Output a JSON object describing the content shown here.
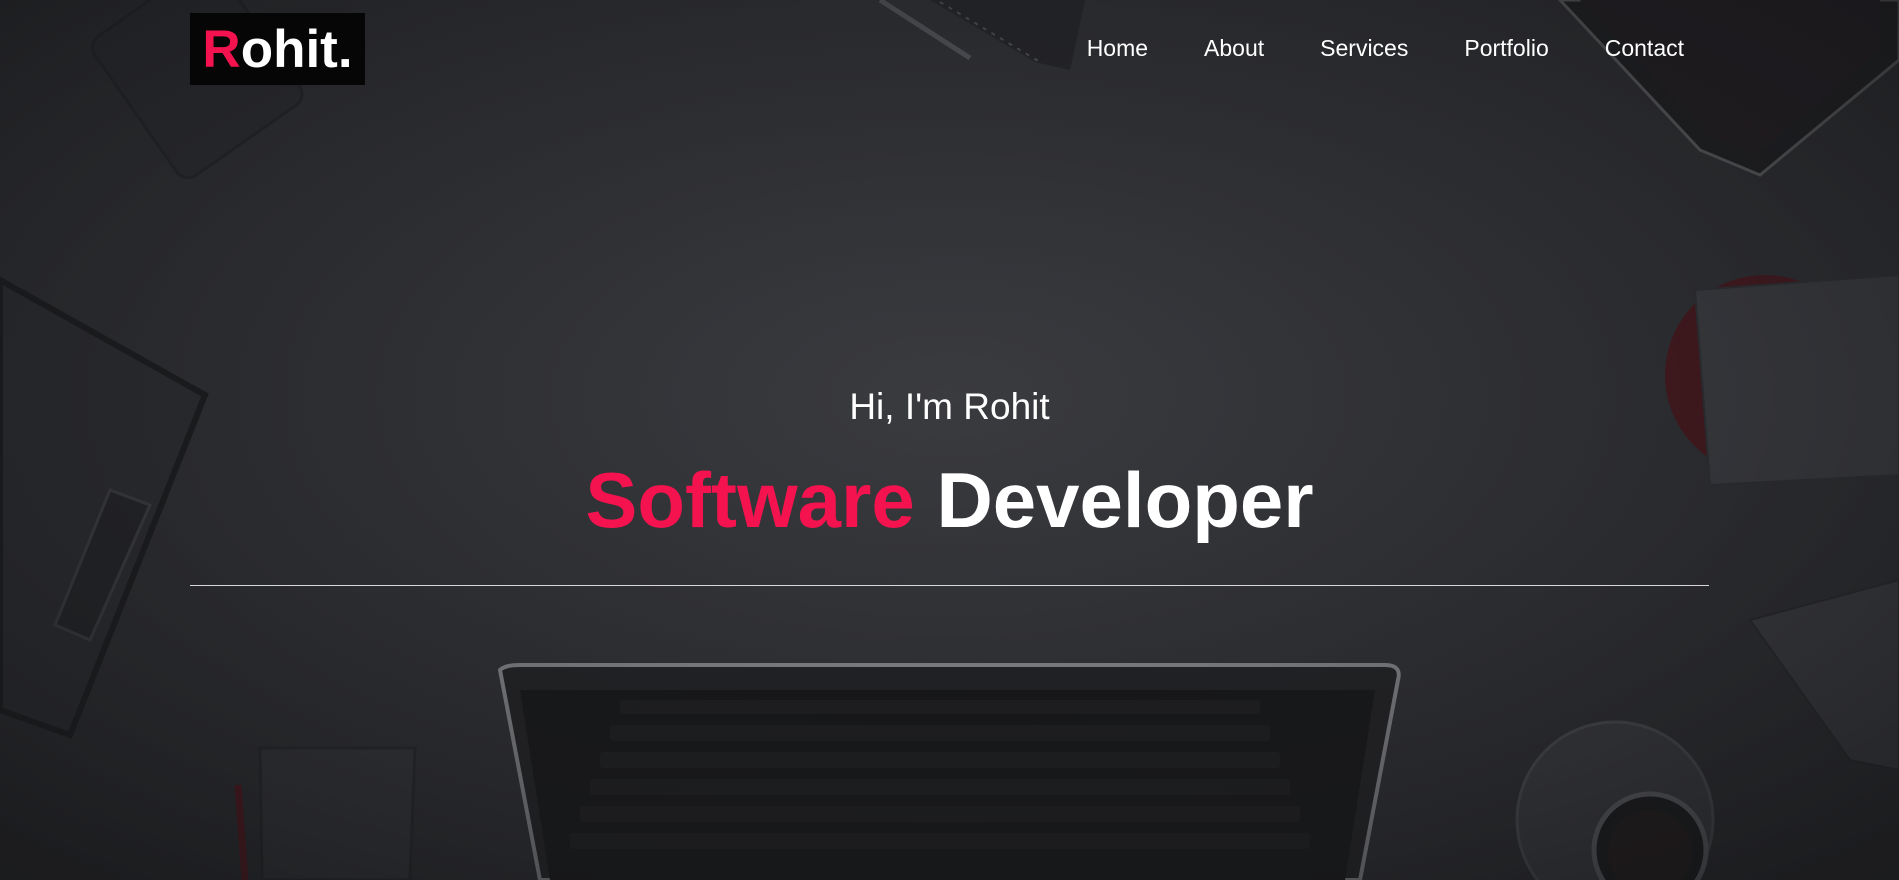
{
  "brand": {
    "logo_initial": "R",
    "logo_rest": "ohit.",
    "accent_color": "#f5134f"
  },
  "nav": {
    "items": [
      {
        "label": "Home"
      },
      {
        "label": "About"
      },
      {
        "label": "Services"
      },
      {
        "label": "Portfolio"
      },
      {
        "label": "Contact"
      }
    ]
  },
  "hero": {
    "greeting": "Hi, I'm Rohit",
    "headline_accent": "Software",
    "headline_rest": "Developer"
  }
}
